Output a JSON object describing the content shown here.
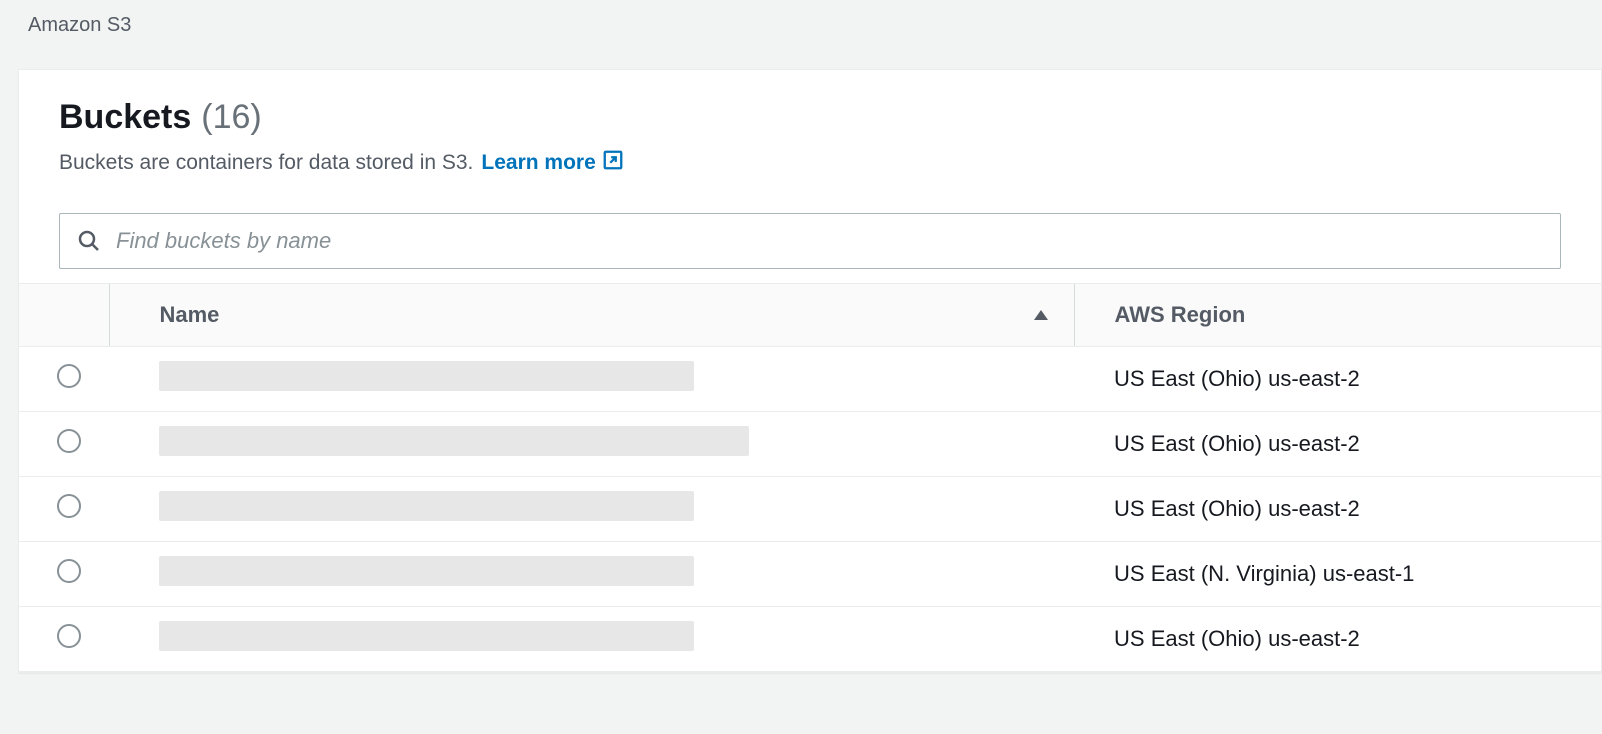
{
  "breadcrumb": "Amazon S3",
  "header": {
    "title": "Buckets",
    "count_label": "(16)",
    "subtitle": "Buckets are containers for data stored in S3.",
    "learn_more_label": "Learn more"
  },
  "search": {
    "placeholder": "Find buckets by name"
  },
  "table": {
    "columns": {
      "name": "Name",
      "region": "AWS Region"
    },
    "rows": [
      {
        "name": "",
        "placeholder_width": 535,
        "region": "US East (Ohio) us-east-2"
      },
      {
        "name": "",
        "placeholder_width": 590,
        "region": "US East (Ohio) us-east-2"
      },
      {
        "name": "",
        "placeholder_width": 535,
        "region": "US East (Ohio) us-east-2"
      },
      {
        "name": "",
        "placeholder_width": 535,
        "region": "US East (N. Virginia) us-east-1"
      },
      {
        "name": "",
        "placeholder_width": 535,
        "region": "US East (Ohio) us-east-2"
      }
    ]
  }
}
